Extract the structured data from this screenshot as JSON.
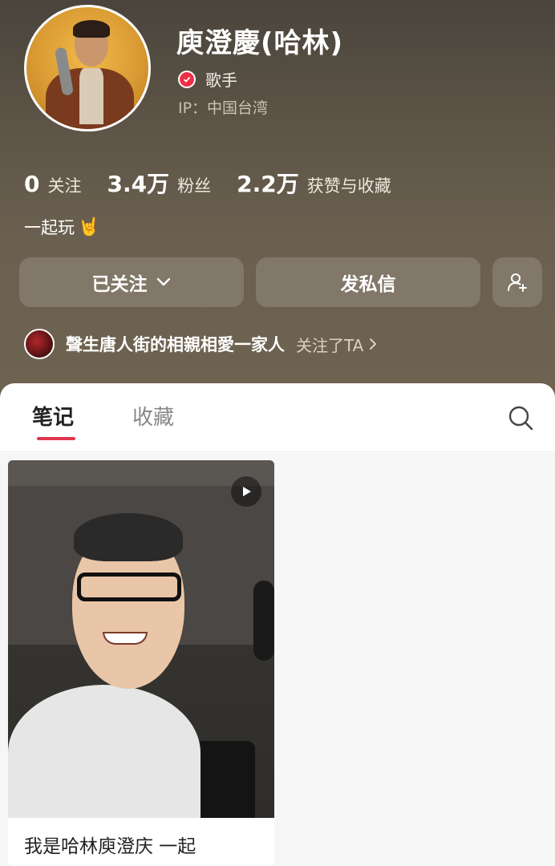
{
  "profile": {
    "name": "庾澄慶(哈林)",
    "verified_label": "歌手",
    "ip": "IP：中国台湾"
  },
  "stats": [
    {
      "value": "0",
      "label": "关注"
    },
    {
      "value": "3.4万",
      "label": "粉丝"
    },
    {
      "value": "2.2万",
      "label": "获赞与收藏"
    }
  ],
  "bio": {
    "text": "一起玩",
    "emoji": "🤘"
  },
  "actions": {
    "follow_label": "已关注",
    "message_label": "发私信"
  },
  "followed_by": {
    "name": "聲生唐人街的相親相愛一家人",
    "action": "关注了TA"
  },
  "tabs": {
    "notes": "笔记",
    "favorites": "收藏"
  },
  "notes": [
    {
      "title": "我是哈林庾澄庆 一起",
      "type": "video"
    }
  ],
  "colors": {
    "accent": "#e0364b",
    "verified": "#ee2f45",
    "header_bg": "#5c5446"
  }
}
